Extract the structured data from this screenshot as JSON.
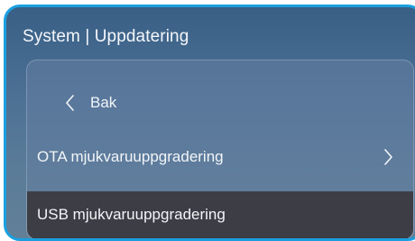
{
  "window": {
    "title": "System | Uppdatering"
  },
  "menu": {
    "back_label": "Bak",
    "items": [
      {
        "label": "OTA mjukvaruuppgradering",
        "icon": "chevron-right-icon"
      },
      {
        "label": "USB mjukvaruuppgradering",
        "selected": true
      }
    ]
  },
  "colors": {
    "frame_border": "#1aa0e0",
    "background_top": "#3a5f86",
    "selected_row": "#3d3e45",
    "text": "#f2f5f8"
  }
}
